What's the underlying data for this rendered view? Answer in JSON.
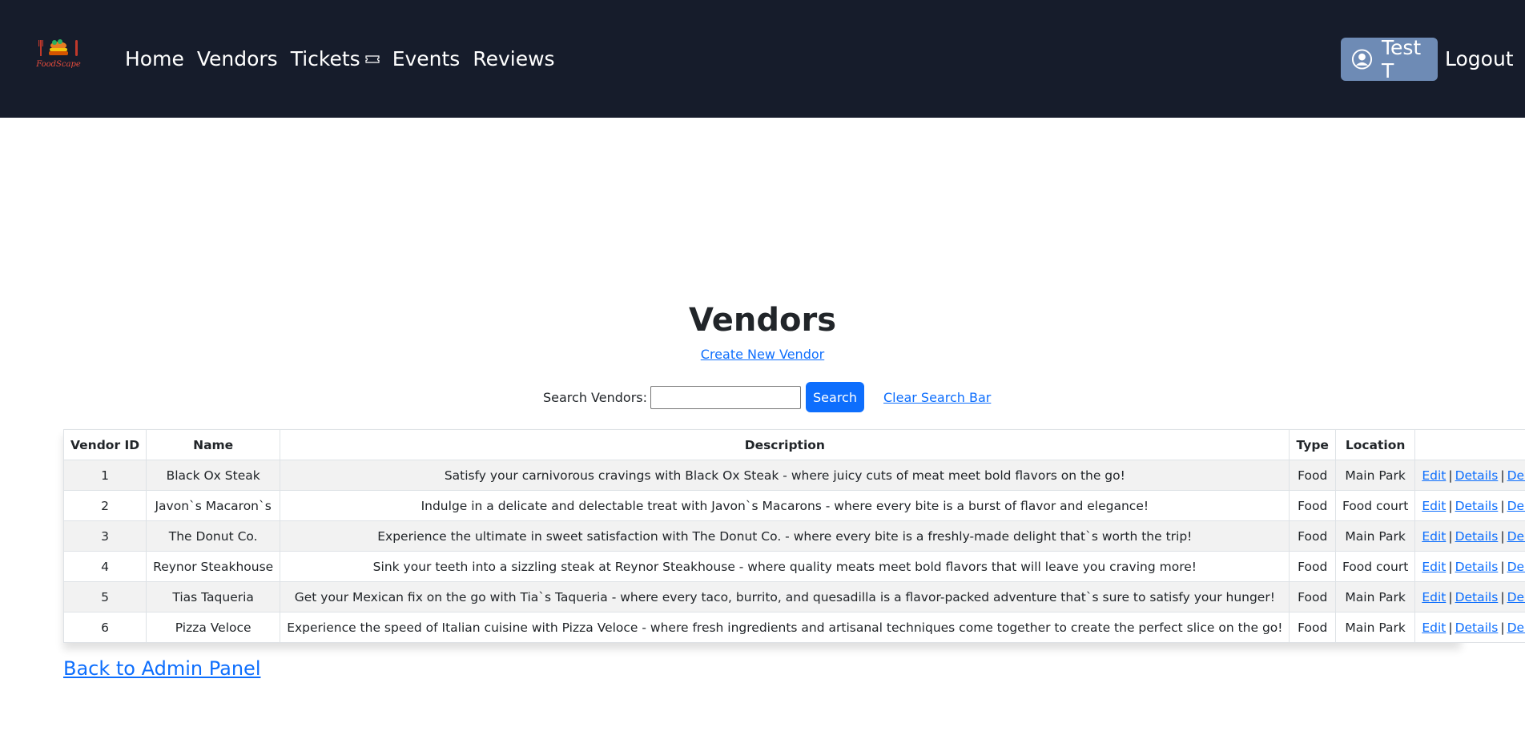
{
  "nav": {
    "logo_text": "FoodScape",
    "links": [
      "Home",
      "Vendors",
      "Tickets",
      "Events",
      "Reviews"
    ],
    "user_label": "Test T",
    "logout_label": "Logout"
  },
  "page": {
    "title": "Vendors",
    "create_link": "Create New Vendor",
    "search_label": "Search Vendors:",
    "search_value": "",
    "search_button": "Search",
    "clear_link": "Clear Search Bar",
    "back_link": "Back to Admin Panel"
  },
  "table": {
    "headers": [
      "Vendor ID",
      "Name",
      "Description",
      "Type",
      "Location",
      ""
    ],
    "action_labels": {
      "edit": "Edit",
      "details": "Details",
      "delete": "Delete",
      "separator": "|"
    },
    "rows": [
      {
        "id": "1",
        "name": "Black Ox Steak",
        "description": "Satisfy your carnivorous cravings with Black Ox Steak - where juicy cuts of meat meet bold flavors on the go!",
        "type": "Food",
        "location": "Main Park"
      },
      {
        "id": "2",
        "name": "Javon`s Macaron`s",
        "description": "Indulge in a delicate and delectable treat with Javon`s Macarons - where every bite is a burst of flavor and elegance!",
        "type": "Food",
        "location": "Food court"
      },
      {
        "id": "3",
        "name": "The Donut Co.",
        "description": "Experience the ultimate in sweet satisfaction with The Donut Co. - where every bite is a freshly-made delight that`s worth the trip!",
        "type": "Food",
        "location": "Main Park"
      },
      {
        "id": "4",
        "name": "Reynor Steakhouse",
        "description": "Sink your teeth into a sizzling steak at Reynor Steakhouse - where quality meats meet bold flavors that will leave you craving more!",
        "type": "Food",
        "location": "Food court"
      },
      {
        "id": "5",
        "name": "Tias Taqueria",
        "description": "Get your Mexican fix on the go with Tia`s Taqueria - where every taco, burrito, and quesadilla is a flavor-packed adventure that`s sure to satisfy your hunger!",
        "type": "Food",
        "location": "Main Park"
      },
      {
        "id": "6",
        "name": "Pizza Veloce",
        "description": "Experience the speed of Italian cuisine with Pizza Veloce - where fresh ingredients and artisanal techniques come together to create the perfect slice on the go!",
        "type": "Food",
        "location": "Main Park"
      }
    ]
  },
  "colors": {
    "navbar": "#161c2b",
    "user_button": "#6e8bb5",
    "primary": "#0d6efd",
    "row_stripe": "#f2f2f2"
  }
}
